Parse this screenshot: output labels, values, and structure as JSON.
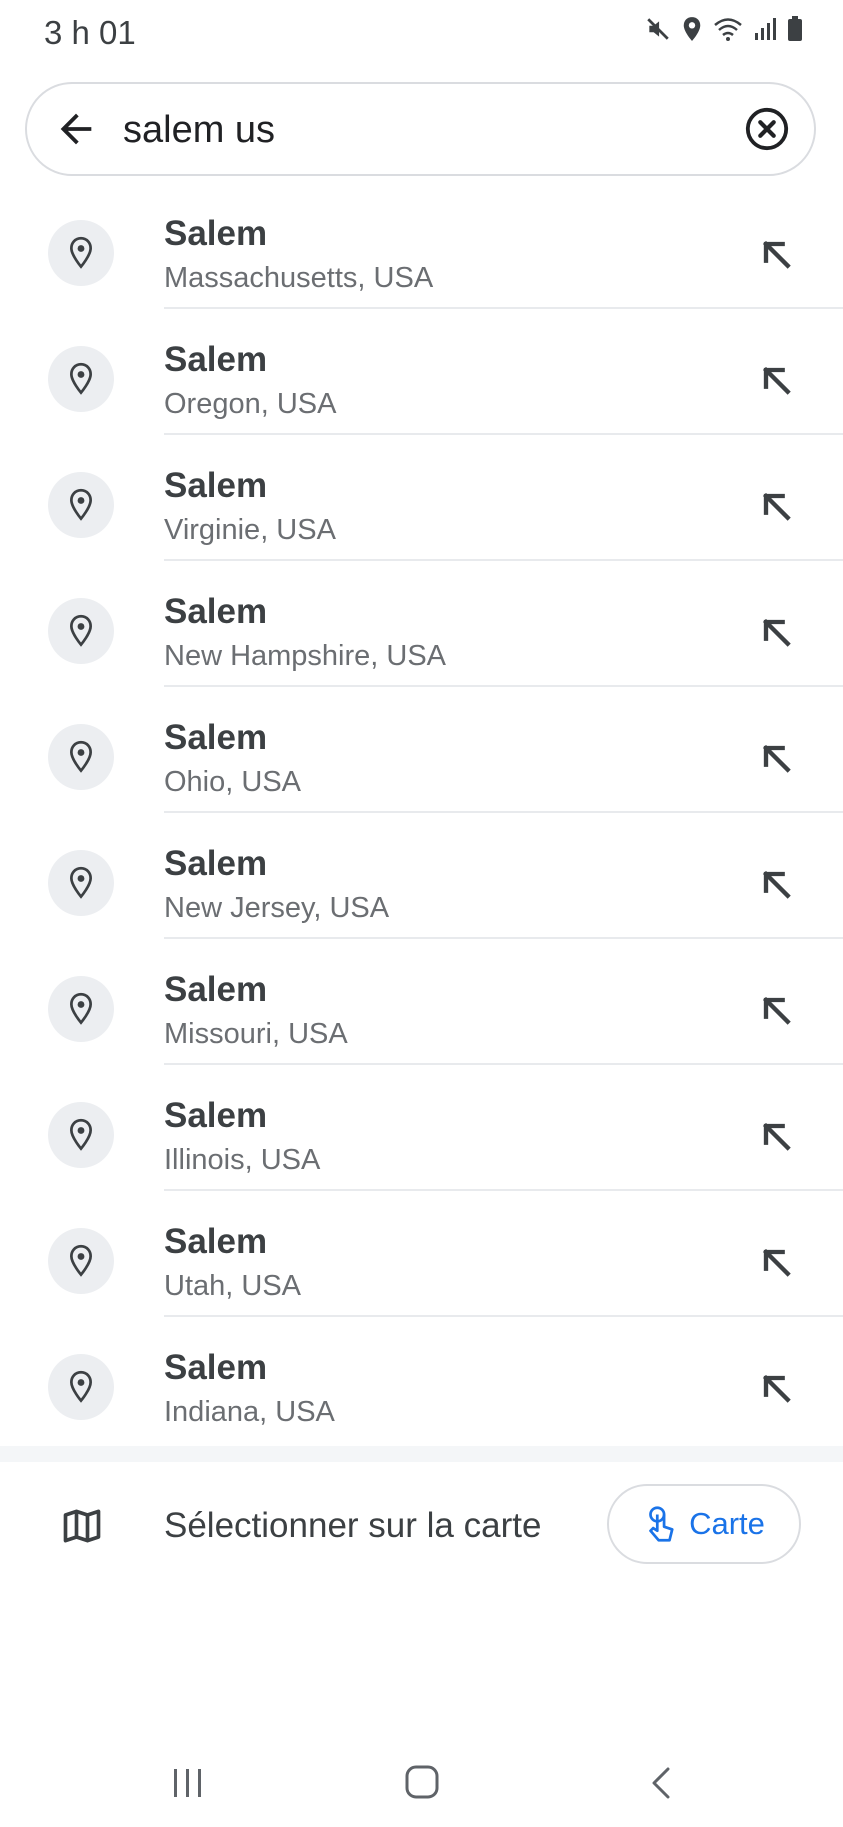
{
  "status_bar": {
    "time": "3 h 01",
    "icons": [
      "mute-icon",
      "location-icon",
      "wifi-icon",
      "signal-icon",
      "battery-icon"
    ]
  },
  "search": {
    "value": "salem us",
    "back_icon": "arrow-back-icon",
    "clear_icon": "clear-circle-icon"
  },
  "results": [
    {
      "title": "Salem",
      "subtitle": "Massachusetts, USA"
    },
    {
      "title": "Salem",
      "subtitle": "Oregon, USA"
    },
    {
      "title": "Salem",
      "subtitle": "Virginie, USA"
    },
    {
      "title": "Salem",
      "subtitle": "New Hampshire, USA"
    },
    {
      "title": "Salem",
      "subtitle": "Ohio, USA"
    },
    {
      "title": "Salem",
      "subtitle": "New Jersey, USA"
    },
    {
      "title": "Salem",
      "subtitle": "Missouri, USA"
    },
    {
      "title": "Salem",
      "subtitle": "Illinois, USA"
    },
    {
      "title": "Salem",
      "subtitle": "Utah, USA"
    },
    {
      "title": "Salem",
      "subtitle": "Indiana, USA"
    }
  ],
  "map_select": {
    "label": "Sélectionner sur la carte",
    "chip_label": "Carte"
  },
  "colors": {
    "accent": "#1a73e8",
    "text_primary": "#3c4043",
    "text_secondary": "#6b6e72",
    "divider": "#e8eaed"
  }
}
